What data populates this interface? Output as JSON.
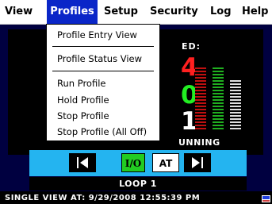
{
  "menubar": {
    "items": [
      "View",
      "Profiles",
      "Setup",
      "Security",
      "Log",
      "Help"
    ],
    "active_index": 1
  },
  "dropdown": {
    "items": [
      "Profile Entry View",
      "Profile Status View",
      "Run Profile",
      "Hold Profile",
      "Stop Profile",
      "Stop Profile (All Off)"
    ]
  },
  "display": {
    "header_fragment": "ED:",
    "digit_red": "4",
    "digit_green": "0",
    "digit_white": "1",
    "status_fragment": "UNNING",
    "colors": {
      "red": "#ff2020",
      "green": "#22ee22",
      "white": "#ffffff"
    }
  },
  "controls": {
    "prev_icon": "left-arrow-icon",
    "io_label": "I/O",
    "at_label": "AT",
    "next_icon": "right-arrow-icon"
  },
  "loop_label": "LOOP 1",
  "status_line": "SINGLE VIEW AT: 9/29/2008 12:55:39 PM",
  "theme": {
    "accent": "#0a26c8",
    "panel": "#000040",
    "control_strip": "#24b4f0"
  }
}
